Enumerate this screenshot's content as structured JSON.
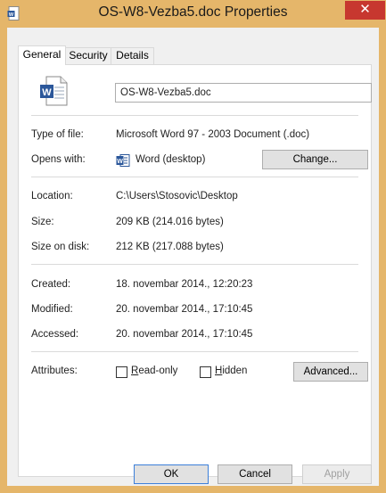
{
  "window": {
    "title": "OS-W8-Vezba5.doc Properties",
    "close_label": "✕"
  },
  "tabs": [
    {
      "label": "General"
    },
    {
      "label": "Security"
    },
    {
      "label": "Details"
    }
  ],
  "general": {
    "file_name": "OS-W8-Vezba5.doc",
    "type_label": "Type of file:",
    "type_value": "Microsoft Word 97 - 2003 Document (.doc)",
    "opens_label": "Opens with:",
    "opens_value": "Word (desktop)",
    "change_button": "Change...",
    "location_label": "Location:",
    "location_value": "C:\\Users\\Stosovic\\Desktop",
    "size_label": "Size:",
    "size_value": "209 KB (214.016 bytes)",
    "disk_label": "Size on disk:",
    "disk_value": "212 KB (217.088 bytes)",
    "created_label": "Created:",
    "created_value": "18. novembar 2014., 12:20:23",
    "modified_label": "Modified:",
    "modified_value": "20. novembar 2014., 17:10:45",
    "accessed_label": "Accessed:",
    "accessed_value": "20. novembar 2014., 17:10:45",
    "attributes_label": "Attributes:",
    "readonly_label": "Read-only",
    "hidden_label": "Hidden",
    "advanced_button": "Advanced..."
  },
  "footer": {
    "ok": "OK",
    "cancel": "Cancel",
    "apply": "Apply"
  },
  "colors": {
    "frame": "#e5b66a",
    "close": "#c7372f",
    "word_blue": "#2b579a"
  }
}
